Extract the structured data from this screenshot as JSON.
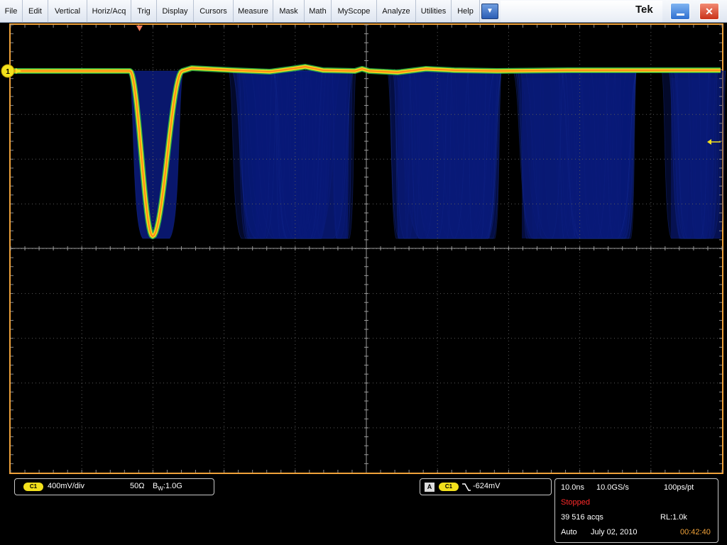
{
  "menu": {
    "items": [
      {
        "label": "File"
      },
      {
        "label": "Edit"
      },
      {
        "label": "Vertical"
      },
      {
        "label": "Horiz/Acq"
      },
      {
        "label": "Trig"
      },
      {
        "label": "Display"
      },
      {
        "label": "Cursors"
      },
      {
        "label": "Measure"
      },
      {
        "label": "Mask"
      },
      {
        "label": "Math"
      },
      {
        "label": "MyScope"
      },
      {
        "label": "Analyze"
      },
      {
        "label": "Utilities"
      },
      {
        "label": "Help"
      }
    ],
    "dropdown_icon": "chevron-down-icon",
    "brand": "Tek",
    "minimize_icon": "minimize-icon",
    "close_icon": "close-icon"
  },
  "display": {
    "ch1_marker": "1",
    "channel_color": "#f3e11c",
    "frame_color": "#f0a23a",
    "persistence_color": "#0a1a78",
    "trace_color": "#ff8c1a"
  },
  "vertical": {
    "channel": "C1",
    "scale": "400mV/div",
    "impedance": "50Ω",
    "bw_prefix": "B",
    "bw_sub": "W",
    "bw_value": ":1.0G"
  },
  "trigger": {
    "source_letter": "A",
    "channel": "C1",
    "slope_icon": "falling-edge-icon",
    "level": "-624mV"
  },
  "horizontal": {
    "time_div": "10.0ns",
    "sample_rate": "10.0GS/s",
    "resolution": "100ps/pt",
    "state": "Stopped",
    "state_color": "#ff2a2a",
    "acqs": "39 516 acqs",
    "record_length": "RL:1.0k",
    "mode": "Auto",
    "date": "July 02, 2010",
    "time": "00:42:40",
    "time_color": "#f0a23a"
  }
}
